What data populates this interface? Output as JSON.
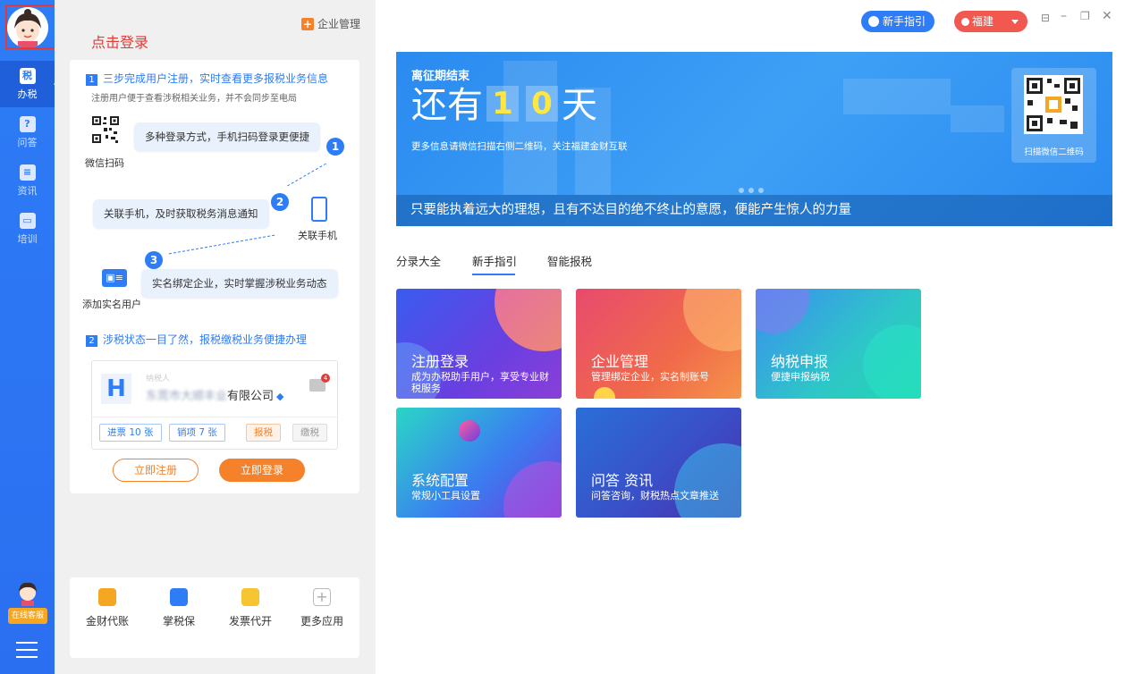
{
  "annotation": {
    "hint": "点击登录"
  },
  "sidebar": {
    "items": [
      {
        "label": "办税",
        "icon": "tax-icon",
        "glyph": "税"
      },
      {
        "label": "问答",
        "icon": "question-icon",
        "glyph": "?"
      },
      {
        "label": "资讯",
        "icon": "news-icon",
        "glyph": "≡"
      },
      {
        "label": "培训",
        "icon": "training-icon",
        "glyph": "▭"
      }
    ],
    "cs_label": "在线客服"
  },
  "header": {
    "enterprise_btn": "企业管理",
    "plus": "+",
    "guide_btn": "新手指引",
    "region": "福建"
  },
  "guide": {
    "step1_num": "1",
    "step1_title": "三步完成用户注册，实时查看更多报税业务信息",
    "step1_sub": "注册用户便于查看涉税相关业务，并不会同步至电局",
    "bubble1": "多种登录方式，手机扫码登录更便捷",
    "cap1": "微信扫码",
    "circle1": "1",
    "bubble2": "关联手机，及时获取税务消息通知",
    "cap2": "关联手机",
    "circle2": "2",
    "bubble3": "实名绑定企业，实时掌握涉税业务动态",
    "cap3": "添加实名用户",
    "circle3": "3",
    "step2_num": "2",
    "step2_title": "涉税状态一目了然，报税缴税业务便捷办理",
    "biz": {
      "letter": "H",
      "type": "纳税人",
      "name_blur": "东莞市大顺丰业",
      "name_suffix": "有限公司",
      "badge": "4",
      "tags": [
        "进票 10 张",
        "销项 7 张",
        "报税",
        "缴税"
      ]
    },
    "register_btn": "立即注册",
    "login_btn": "立即登录"
  },
  "apps": [
    {
      "label": "金财代账",
      "color": "#f5a623"
    },
    {
      "label": "掌税保",
      "color": "#2e7cf6"
    },
    {
      "label": "发票代开",
      "color": "#f7c531"
    },
    {
      "label": "更多应用",
      "color": "#bbbbbb"
    }
  ],
  "banner": {
    "small_title": "离征期结束",
    "prefix": "还有",
    "digit1": "1",
    "digit2": "0",
    "suffix": "天",
    "note": "更多信息请微信扫描右侧二维码，关注福建金财互联",
    "qr_caption": "扫描微信二维码",
    "strip": "只要能执着远大的理想，且有不达目的绝不终止的意愿，便能产生惊人的力量"
  },
  "tabs": [
    "分录大全",
    "新手指引",
    "智能报税"
  ],
  "tiles": [
    {
      "title": "注册登录",
      "desc": "成为办税助手用户，享受专业财税服务"
    },
    {
      "title": "企业管理",
      "desc": "管理绑定企业，实名制账号"
    },
    {
      "title": "纳税申报",
      "desc": "便捷申报纳税"
    },
    {
      "title": "系统配置",
      "desc": "常规小工具设置"
    },
    {
      "title": "问答 资讯",
      "desc": "问答咨询，财税热点文章推送"
    }
  ]
}
